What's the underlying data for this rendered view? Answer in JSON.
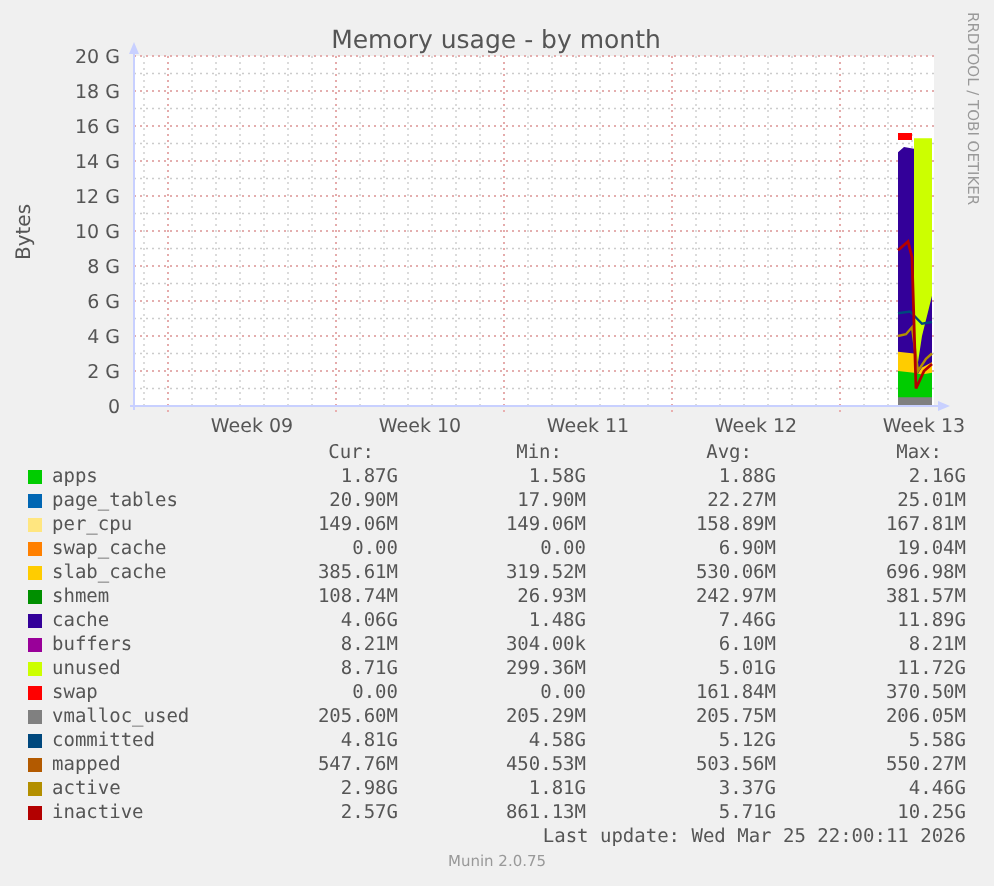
{
  "chart": {
    "chart_data": {
      "type": "area",
      "title": "Memory usage - by month",
      "ylabel": "Bytes",
      "categories": [
        "Week 09",
        "Week 10",
        "Week 11",
        "Week 12",
        "Week 13"
      ],
      "yticks": [
        {
          "value": 0,
          "label": "0"
        },
        {
          "value": 2,
          "label": "2 G"
        },
        {
          "value": 4,
          "label": "4 G"
        },
        {
          "value": 6,
          "label": "6 G"
        },
        {
          "value": 8,
          "label": "8 G"
        },
        {
          "value": 10,
          "label": "10 G"
        },
        {
          "value": 12,
          "label": "12 G"
        },
        {
          "value": 14,
          "label": "14 G"
        },
        {
          "value": 16,
          "label": "16 G"
        },
        {
          "value": 18,
          "label": "18 G"
        },
        {
          "value": 20,
          "label": "20 G"
        }
      ],
      "ylim": [
        0,
        20
      ],
      "grid": true
    },
    "watermark": "RRDTOOL / TOBI OETIKER"
  },
  "legend": {
    "headers": [
      "Cur:",
      "Min:",
      "Avg:",
      "Max:"
    ],
    "rows": [
      {
        "name": "apps",
        "color": "#00cc00",
        "cur": "1.87G",
        "min": "1.58G",
        "avg": "1.88G",
        "max": "2.16G"
      },
      {
        "name": "page_tables",
        "color": "#0066b3",
        "cur": "20.90M",
        "min": "17.90M",
        "avg": "22.27M",
        "max": "25.01M"
      },
      {
        "name": "per_cpu",
        "color": "#ffe680",
        "cur": "149.06M",
        "min": "149.06M",
        "avg": "158.89M",
        "max": "167.81M"
      },
      {
        "name": "swap_cache",
        "color": "#ff8000",
        "cur": "0.00",
        "min": "0.00",
        "avg": "6.90M",
        "max": "19.04M"
      },
      {
        "name": "slab_cache",
        "color": "#ffcc00",
        "cur": "385.61M",
        "min": "319.52M",
        "avg": "530.06M",
        "max": "696.98M"
      },
      {
        "name": "shmem",
        "color": "#008f00",
        "cur": "108.74M",
        "min": "26.93M",
        "avg": "242.97M",
        "max": "381.57M"
      },
      {
        "name": "cache",
        "color": "#330099",
        "cur": "4.06G",
        "min": "1.48G",
        "avg": "7.46G",
        "max": "11.89G"
      },
      {
        "name": "buffers",
        "color": "#990099",
        "cur": "8.21M",
        "min": "304.00k",
        "avg": "6.10M",
        "max": "8.21M"
      },
      {
        "name": "unused",
        "color": "#ccff00",
        "cur": "8.71G",
        "min": "299.36M",
        "avg": "5.01G",
        "max": "11.72G"
      },
      {
        "name": "swap",
        "color": "#ff0000",
        "cur": "0.00",
        "min": "0.00",
        "avg": "161.84M",
        "max": "370.50M"
      },
      {
        "name": "vmalloc_used",
        "color": "#808080",
        "cur": "205.60M",
        "min": "205.29M",
        "avg": "205.75M",
        "max": "206.05M"
      },
      {
        "name": "committed",
        "color": "#00487d",
        "cur": "4.81G",
        "min": "4.58G",
        "avg": "5.12G",
        "max": "5.58G"
      },
      {
        "name": "mapped",
        "color": "#b35a00",
        "cur": "547.76M",
        "min": "450.53M",
        "avg": "503.56M",
        "max": "550.27M"
      },
      {
        "name": "active",
        "color": "#b38f00",
        "cur": "2.98G",
        "min": "1.81G",
        "avg": "3.37G",
        "max": "4.46G"
      },
      {
        "name": "inactive",
        "color": "#b30000",
        "cur": "2.57G",
        "min": "861.13M",
        "avg": "5.71G",
        "max": "10.25G"
      }
    ]
  },
  "last_update": "Last update: Wed Mar 25 22:00:11 2026",
  "footer": "Munin 2.0.75"
}
